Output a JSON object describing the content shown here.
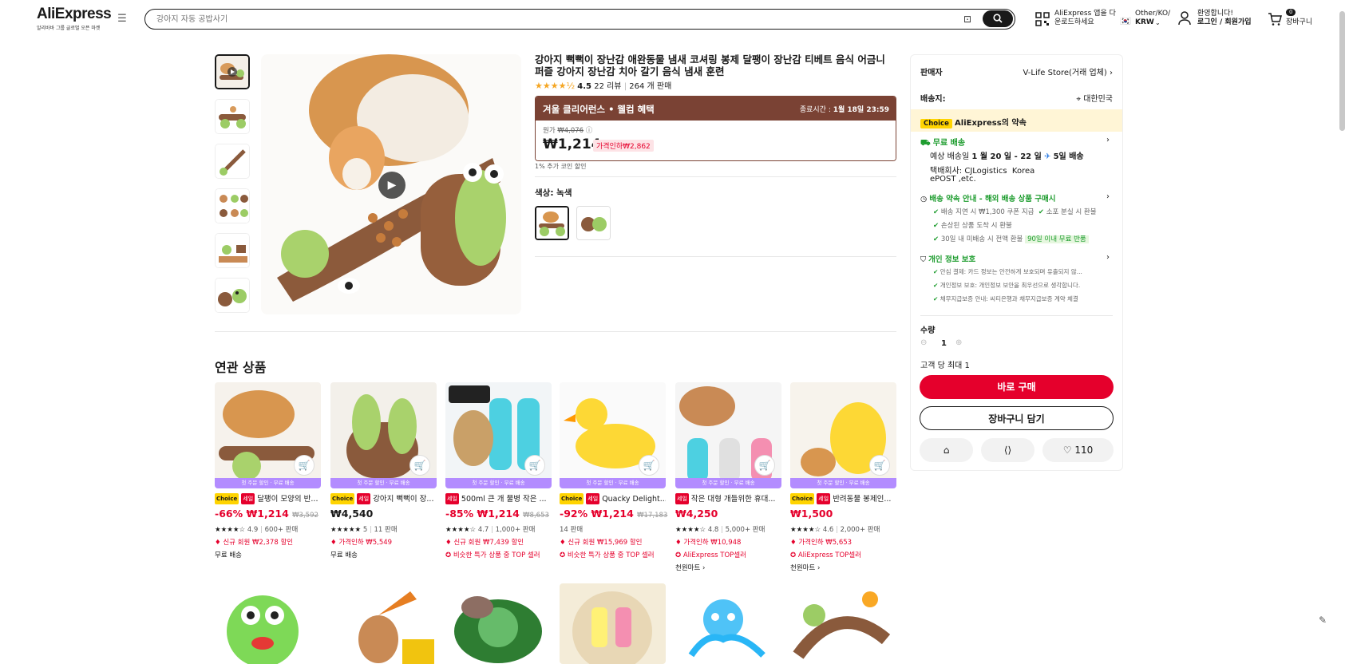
{
  "header": {
    "logo": "AliExpress",
    "logo_sub": "알리바바 그룹 글로벌 오픈 마켓",
    "search_placeholder": "강아지 자동 공밥사기",
    "app_line1": "AliExpress 앱을 다",
    "app_line2": "운로드하세요",
    "region_line1": "Other/KO/",
    "region_line2": "KRW",
    "account_line1": "환영합니다!",
    "account_line2": "로그인 / 회원가입",
    "cart_count": "0",
    "cart_label": "장바구니"
  },
  "product": {
    "title": "강아지 뻑뻑이 장난감 애완동물 냄새 코셔링 봉제 달팽이 장난감 티베트 음식 어금니 퍼즐 강아지 장난감 치아 갈기 음식 냄새 훈련",
    "rating": "4.5",
    "reviews": "22 리뷰",
    "sold": "264 개 판매",
    "deal_title": "겨울 클리어런스 • 웰컴 혜택",
    "deal_end_label": "종료시간 :",
    "deal_end": "1월 18일 23:59",
    "orig_label": "원가",
    "orig_price": "₩4,076",
    "price": "₩1,214",
    "discount_badge": "가격인하₩2,862",
    "coin_note": "1% 추가 코인 할인",
    "color_label": "색상: 녹색"
  },
  "sidebar": {
    "seller_label": "판매자",
    "seller_name": "V-Life Store(거래 업체)",
    "ship_to_label": "배송지:",
    "ship_to": "대한민국",
    "choice_tag": "Choice",
    "promise": "AliExpress의 약속",
    "free_ship": "무료 배송",
    "eta_prefix": "예상 배송일",
    "eta_dates": "1 월 20 일 - 22 일",
    "eta_days": "5일 배송",
    "carrier_label": "택배회사:",
    "carrier1": "CJLogistics",
    "carrier2": "Korea",
    "carrier3": "ePOST ,etc.",
    "promise2": "배송 약속 안내 - 해외 배송 상품 구매시",
    "p2a": "배송 지연 시 ₩1,300 쿠폰 지급",
    "p2b": "소포 분실 시 환불",
    "p2c": "손상된 상품 도착 시 환불",
    "p2d": "30일 내 미배송 시 전액 환불",
    "p2e": "90일 이내 무료 반품",
    "privacy": "개인 정보 보호",
    "pr1": "안심 결제: 카드 정보는 안전하게 보호되며 유출되지 않...",
    "pr2": "개인정보 보호: 개인정보 보안을 최우선으로 생각합니다.",
    "pr3": "채무지급보증 안내: 씨티은행과 채무지급보증 계약 체결",
    "qty_label": "수량",
    "qty": "1",
    "max_label": "고객 당 최대 1",
    "buy_now": "바로 구매",
    "add_cart": "장바구니 담기",
    "wish_count": "110"
  },
  "related": {
    "title": "연관 상품",
    "strip": "첫 주문 할인 · 무료 배송",
    "items": [
      {
        "title": "달팽이 모양의 반...",
        "choice": "Choice",
        "sale": "세일",
        "discount": "-66%",
        "price": "₩1,214",
        "old": "₩3,592",
        "stars": "★★★★☆",
        "rating": "4.9",
        "sold": "600+ 판매",
        "line1": "신규 회원 ₩2,378 할인",
        "line2": "무료 배송"
      },
      {
        "title": "강아지 뻑뻑이 장...",
        "choice": "Choice",
        "sale": "세일",
        "discount": "",
        "price": "₩4,540",
        "old": "",
        "stars": "★★★★★",
        "rating": "5",
        "sold": "11 판매",
        "line1": "가격인하 ₩5,549",
        "line2": "무료 배송"
      },
      {
        "title": "500ml 큰 개 물병 작은 ...",
        "choice": "",
        "sale": "세일",
        "discount": "-85%",
        "price": "₩1,214",
        "old": "₩8,653",
        "stars": "★★★★☆",
        "rating": "4.7",
        "sold": "1,000+ 판매",
        "line1": "신규 회원 ₩7,439 할인",
        "line2": "비슷한 특가 상품 중 TOP 셀러"
      },
      {
        "title": "Quacky Delight...",
        "choice": "Choice",
        "sale": "세일",
        "discount": "-92%",
        "price": "₩1,214",
        "old": "₩17,183",
        "stars": "",
        "rating": "",
        "sold": "14 판매",
        "line1": "신규 회원 ₩15,969 할인",
        "line2": "비슷한 특가 상품 중 TOP 셀러"
      },
      {
        "title": "작은 대형 개들위한 휴대...",
        "choice": "",
        "sale": "세일",
        "discount": "",
        "price": "₩4,250",
        "old": "",
        "stars": "★★★★☆",
        "rating": "4.8",
        "sold": "5,000+ 판매",
        "line1": "가격인하 ₩10,948",
        "line2": "AliExpress TOP셀러",
        "line3": "천원마트 ›"
      },
      {
        "title": "반려동물 봉제인...",
        "choice": "Choice",
        "sale": "세일",
        "discount": "",
        "price": "₩1,500",
        "old": "",
        "stars": "★★★★☆",
        "rating": "4.6",
        "sold": "2,000+ 판매",
        "line1": "가격인하 ₩5,653",
        "line2": "AliExpress TOP셀러",
        "line3": "천원마트 ›"
      }
    ]
  },
  "colors": {
    "accent": "#e5002c",
    "deal": "#7a4234",
    "choice": "#ffd400"
  }
}
